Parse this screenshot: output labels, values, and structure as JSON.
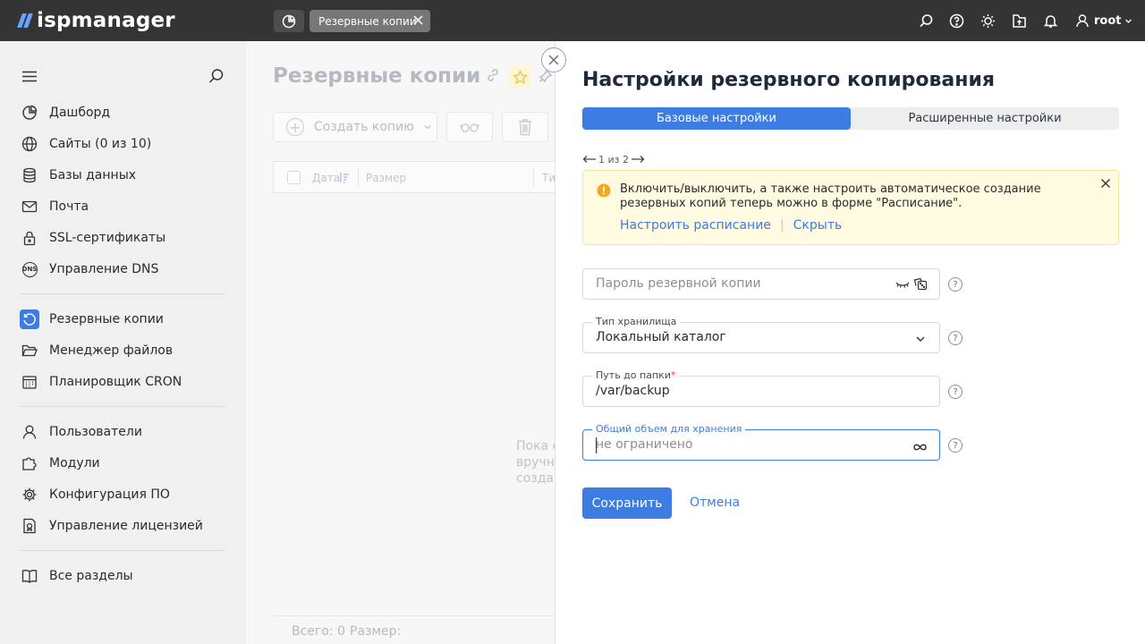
{
  "topbar": {
    "logo_text": "ispmanager",
    "tab_label": "Резервные копии",
    "user_name": "root"
  },
  "sidebar": {
    "items_group1": [
      {
        "label": "Дашборд",
        "icon": "dashboard-icon"
      },
      {
        "label": "Сайты (0 из 10)",
        "icon": "globe-icon"
      },
      {
        "label": "Базы данных",
        "icon": "database-icon"
      },
      {
        "label": "Почта",
        "icon": "mail-icon"
      },
      {
        "label": "SSL-сертификаты",
        "icon": "lock-icon"
      },
      {
        "label": "Управление DNS",
        "icon": "dns-icon"
      }
    ],
    "items_group2": [
      {
        "label": "Резервные копии",
        "icon": "backup-icon",
        "active": true
      },
      {
        "label": "Менеджер файлов",
        "icon": "folder-icon"
      },
      {
        "label": "Планировщик CRON",
        "icon": "calendar-icon"
      }
    ],
    "items_group3": [
      {
        "label": "Пользователи",
        "icon": "user-icon"
      },
      {
        "label": "Модули",
        "icon": "modules-icon"
      },
      {
        "label": "Конфигурация ПО",
        "icon": "gear-icon"
      },
      {
        "label": "Управление лицензией",
        "icon": "license-icon"
      }
    ],
    "items_group4": [
      {
        "label": "Все разделы",
        "icon": "book-icon"
      }
    ],
    "dns_badge": "DNS"
  },
  "background_page": {
    "title": "Резервные копии",
    "create_button": "Создать копию",
    "columns": {
      "date": "Дата",
      "size": "Размер",
      "type": "Ти"
    },
    "empty_text": "Пока е\nвручну\nсоздан",
    "footer_total": "Всего: 0",
    "footer_size": "Размер:"
  },
  "panel": {
    "title": "Настройки резервного копирования",
    "tabs": {
      "basic": "Базовые настройки",
      "advanced": "Расширенные настройки"
    },
    "pager": {
      "text": "1 из 2"
    },
    "alert": {
      "text": "Включить/выключить, а также настроить автоматическое создание резервных копий теперь можно в форме \"Расписание\".",
      "link_schedule": "Настроить расписание",
      "link_hide": "Скрыть"
    },
    "fields": {
      "password": {
        "placeholder": "Пароль резервной копии"
      },
      "storage_type": {
        "label": "Тип хранилища",
        "value": "Локальный каталог"
      },
      "folder_path": {
        "label": "Путь до папки",
        "required_mark": "*",
        "value": "/var/backup"
      },
      "storage_volume": {
        "label": "Общий объем для хранения",
        "placeholder": "не ограничено"
      }
    },
    "help_glyph": "?",
    "save_button": "Сохранить",
    "cancel_link": "Отмена"
  },
  "colors": {
    "accent": "#3d7ce2",
    "topbar_bg": "#343434",
    "sidebar_bg": "#f0f0f0",
    "alert_bg": "#fffae0"
  }
}
